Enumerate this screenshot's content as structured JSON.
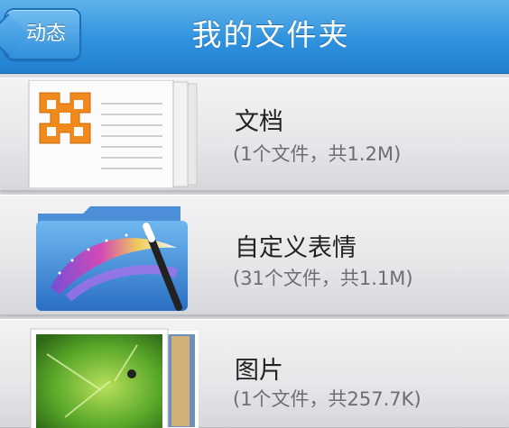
{
  "header": {
    "back_label": "动态",
    "title": "我的文件夹"
  },
  "folders": [
    {
      "name": "文档",
      "info": "(1个文件，共1.2M)",
      "icon": "office-document-icon"
    },
    {
      "name": "自定义表情",
      "info": "(31个文件，共1.1M)",
      "icon": "magic-wand-folder-icon"
    },
    {
      "name": "图片",
      "info": "(1个文件，共257.7K)",
      "icon": "photo-stack-icon"
    }
  ],
  "colors": {
    "navbar": "#2f92de",
    "office_logo": "#f08a1c"
  }
}
